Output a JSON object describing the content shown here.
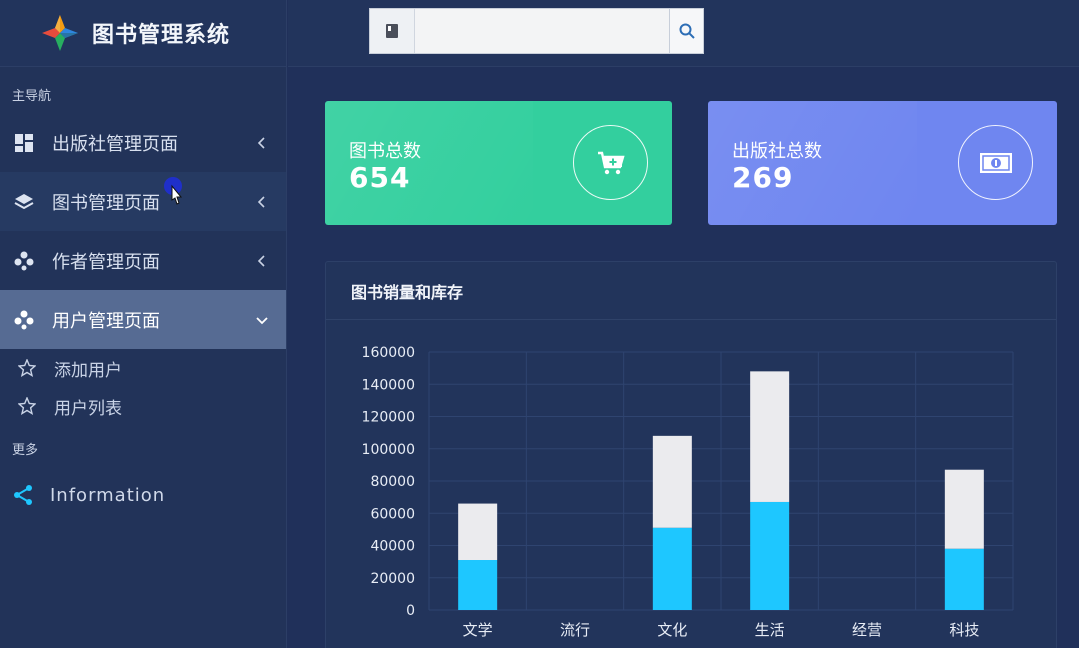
{
  "app": {
    "title": "图书管理系统"
  },
  "sidebar": {
    "section_main": "主导航",
    "items": [
      {
        "label": "出版社管理页面",
        "icon": "dashboard-icon"
      },
      {
        "label": "图书管理页面",
        "icon": "layers-icon"
      },
      {
        "label": "作者管理页面",
        "icon": "puzzle-icon"
      },
      {
        "label": "用户管理页面",
        "icon": "puzzle-icon"
      }
    ],
    "sub_items": [
      {
        "label": "添加用户",
        "icon": "star-icon"
      },
      {
        "label": "用户列表",
        "icon": "star-icon"
      }
    ],
    "section_more": "更多",
    "info": {
      "label": "Information",
      "icon": "share-icon"
    }
  },
  "search": {
    "value": "",
    "placeholder": ""
  },
  "cards": [
    {
      "title": "图书总数",
      "value": "654",
      "icon": "cart-plus-icon",
      "color": "#33cf9e"
    },
    {
      "title": "出版社总数",
      "value": "269",
      "icon": "money-icon",
      "color": "#6f86f0"
    }
  ],
  "panel": {
    "title": "图书销量和库存"
  },
  "chart_data": {
    "type": "bar",
    "stacked": true,
    "categories": [
      "文学",
      "流行",
      "文化",
      "生活",
      "经营",
      "科技"
    ],
    "series": [
      {
        "values": [
          31000,
          0,
          51000,
          67000,
          0,
          38000
        ],
        "color": "#1ec7ff"
      },
      {
        "values": [
          35000,
          0,
          57000,
          81000,
          0,
          49000
        ],
        "color": "#ebebee"
      }
    ],
    "yticks": [
      0,
      20000,
      40000,
      60000,
      80000,
      100000,
      120000,
      140000,
      160000
    ],
    "ylim": [
      0,
      160000
    ],
    "grid": true
  }
}
